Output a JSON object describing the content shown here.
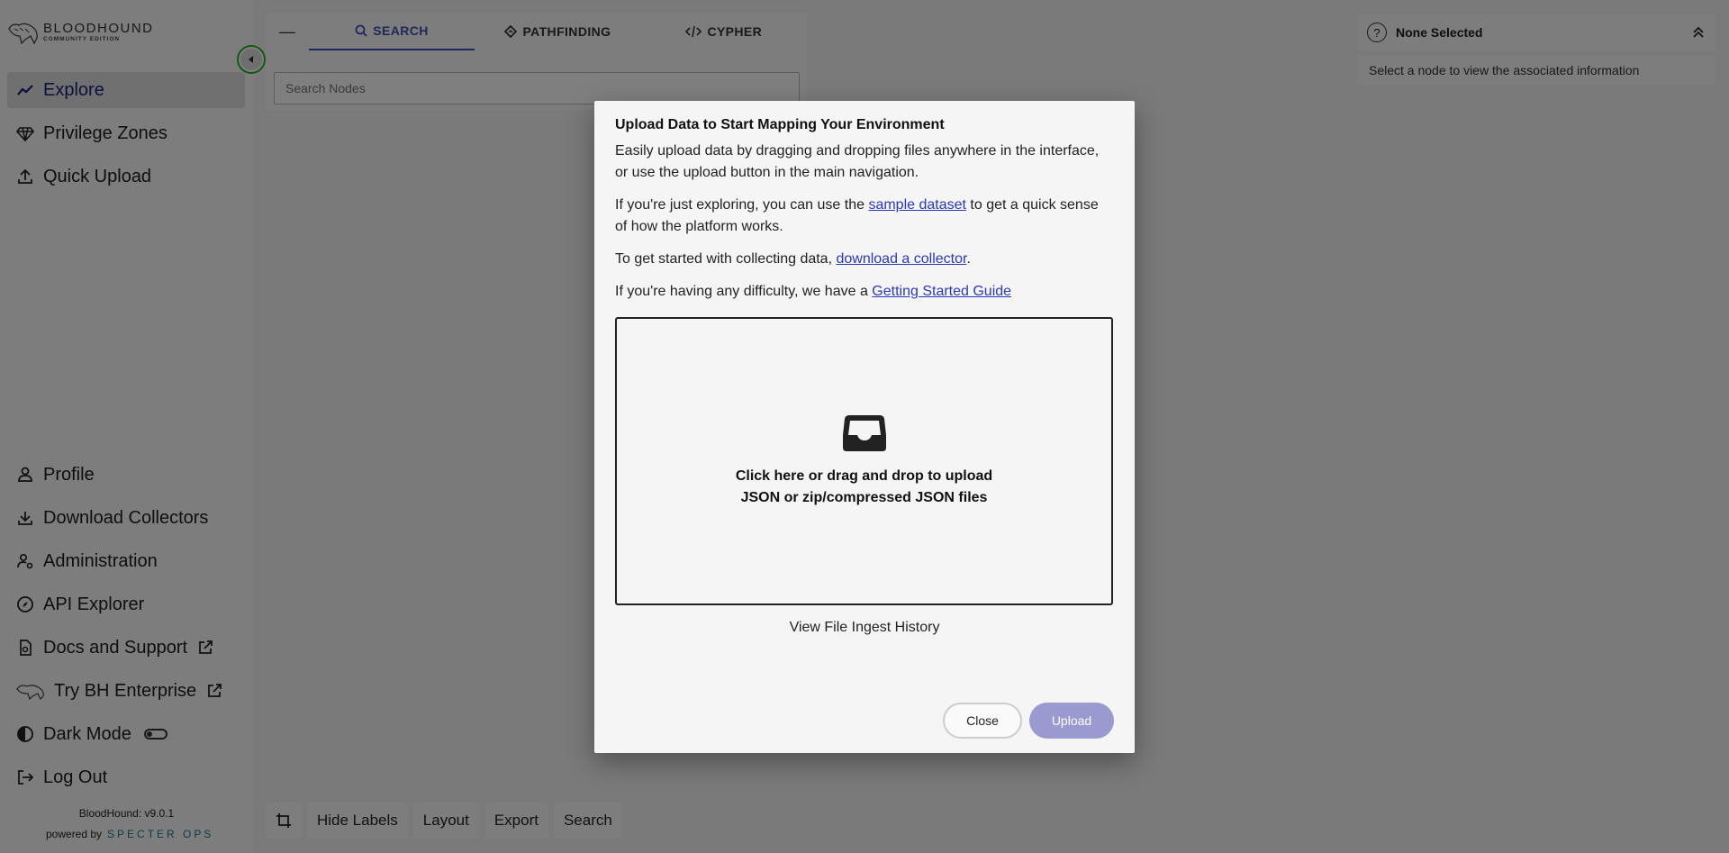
{
  "brand": {
    "title": "BLOODHOUND",
    "subtitle": "COMMUNITY EDITION"
  },
  "sidebar": {
    "top_items": [
      {
        "label": "Explore",
        "icon": "trend-icon",
        "active": true
      },
      {
        "label": "Privilege Zones",
        "icon": "gem-icon"
      },
      {
        "label": "Quick Upload",
        "icon": "upload-icon"
      }
    ],
    "bottom_items": [
      {
        "label": "Profile",
        "icon": "user-icon"
      },
      {
        "label": "Download Collectors",
        "icon": "download-icon"
      },
      {
        "label": "Administration",
        "icon": "user-gear-icon"
      },
      {
        "label": "API Explorer",
        "icon": "compass-icon"
      },
      {
        "label": "Docs and Support",
        "icon": "docs-icon"
      },
      {
        "label": "Try BH Enterprise",
        "icon": "hound-icon"
      },
      {
        "label": "Dark Mode",
        "icon": "contrast-icon"
      },
      {
        "label": "Log Out",
        "icon": "logout-icon"
      }
    ],
    "version": "BloodHound: v9.0.1",
    "powered_by": "powered by",
    "powered_brand": "SPECTER OPS"
  },
  "search_panel": {
    "minus": "—",
    "tabs": [
      {
        "label": "SEARCH",
        "icon": "search-icon",
        "active": true
      },
      {
        "label": "PATHFINDING",
        "icon": "diamond-icon"
      },
      {
        "label": "CYPHER",
        "icon": "code-icon"
      }
    ],
    "placeholder": "Search Nodes"
  },
  "info_panel": {
    "title": "None Selected",
    "body": "Select a node to view the associated information"
  },
  "toolbar": {
    "items": [
      "Hide Labels",
      "Layout",
      "Export",
      "Search"
    ]
  },
  "modal": {
    "title": "Upload Data to Start Mapping Your Environment",
    "p1": "Easily upload data by dragging and dropping files anywhere in the interface, or use the upload button in the main navigation.",
    "p2_before": "If you're just exploring, you can use the ",
    "p2_link": "sample dataset",
    "p2_after": " to get a quick sense of how the platform works.",
    "p3_before": "To get started with collecting data, ",
    "p3_link": "download a collector",
    "p3_after": ".",
    "p4_before": "If you're having any difficulty, we have a ",
    "p4_link": "Getting Started Guide",
    "drop_line1": "Click here or drag and drop to upload",
    "drop_line2": "JSON or zip/compressed JSON files",
    "history": "View File Ingest History",
    "close_label": "Close",
    "upload_label": "Upload"
  }
}
